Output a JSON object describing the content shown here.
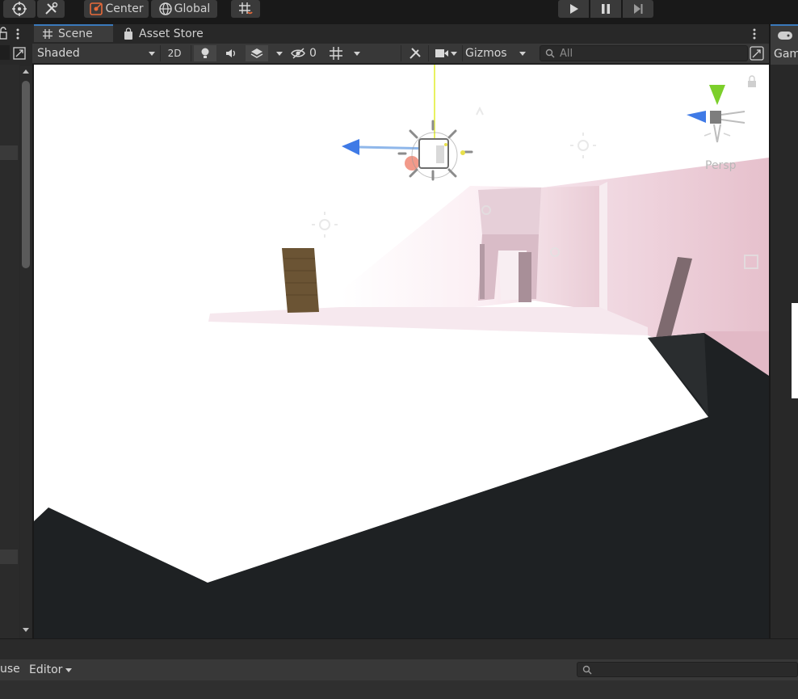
{
  "toolbar": {
    "pivot_label": "Center",
    "space_label": "Global"
  },
  "scene_tabs": [
    {
      "label": "Scene"
    },
    {
      "label": "Asset Store"
    }
  ],
  "scene_toolbar": {
    "draw_mode": "Shaded",
    "two_d_label": "2D",
    "hidden_count": "0",
    "gizmos_label": "Gizmos",
    "search_placeholder": "All"
  },
  "viewport": {
    "projection_label": "Persp"
  },
  "right_panel": {
    "tab_label": "Gam"
  },
  "bottom": {
    "left_label": "use",
    "editor_label": "Editor"
  },
  "colors": {
    "accent_tab": "#3a79bb",
    "gizmo_green": "#7ccf2b",
    "gizmo_blue": "#3f7ae6",
    "gizmo_red": "#e35b45"
  }
}
